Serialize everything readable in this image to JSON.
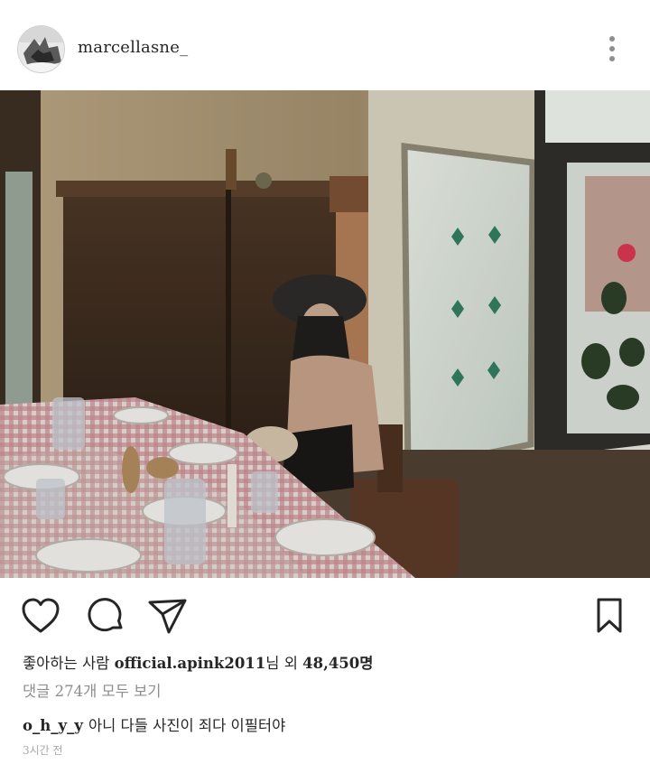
{
  "post": {
    "username": "marcellasne_",
    "avatar_icon": "profile-photo",
    "more_icon": "three-dots-vertical-icon",
    "photo_description_icon": "photo"
  },
  "actions": {
    "like_icon": "heart-icon",
    "comment_icon": "comment-bubble-icon",
    "share_icon": "paper-plane-icon",
    "save_icon": "bookmark-icon"
  },
  "likes": {
    "prefix": "좋아하는 사람",
    "user": "official.apink2011",
    "middle": "님 외",
    "count": "48,450명"
  },
  "comments": {
    "view_all": "댓글 274개 모두 보기",
    "items": [
      {
        "user": "o_h_y_y",
        "text": "아니 다들 사진이 죄다 이필터야"
      }
    ]
  },
  "timestamp": "3시간 전",
  "colors": {
    "text": "#262626",
    "secondary": "#8e8e8e",
    "timestamp": "#a8a8a8",
    "background": "#ffffff"
  }
}
